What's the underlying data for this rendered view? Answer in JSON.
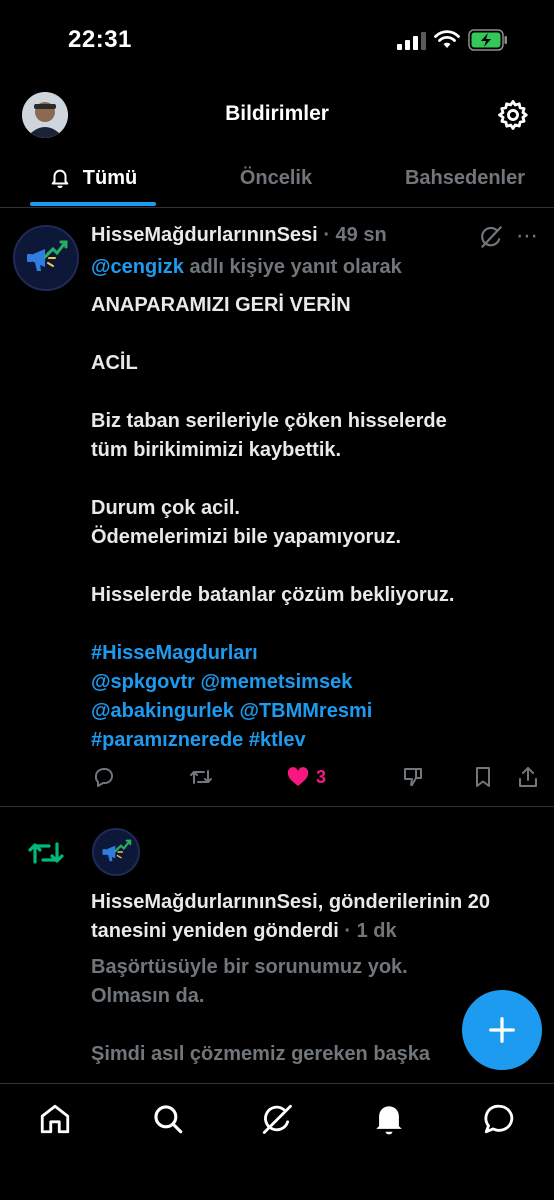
{
  "status_bar": {
    "time": "22:31",
    "signal_icon": "cellular-signal-icon",
    "wifi_icon": "wifi-icon",
    "battery_icon": "battery-charging-icon"
  },
  "header": {
    "title": "Bildirimler",
    "settings_icon": "gear-icon"
  },
  "tabs": [
    {
      "label": "Tümü",
      "active": true
    },
    {
      "label": "Öncelik",
      "active": false
    },
    {
      "label": "Bahsedenler",
      "active": false
    }
  ],
  "tweet": {
    "author": "HisseMağdurlarınınSesi",
    "separator": "·",
    "time_ago": "49 sn",
    "reply_to_handle": "@cengizk",
    "reply_suffix": "adlı kişiye yanıt olarak",
    "body": "ANAPARAMIZI GERİ VERİN\n\nACİL\n\nBiz taban serileriyle çöken hisselerde\ntüm  birikimimizi kaybettik.\n\nDurum çok acil.\nÖdemelerimizi bile yapamıyoruz.\n\nHisselerde batanlar çözüm bekliyoruz.",
    "tags": "#HisseMagdurları\n@spkgovtr @memetsimsek\n@abakingurlek @TBMMresmi\n#paramıznerede #ktlev",
    "like_count": "3",
    "like_color": "#f91880"
  },
  "repost_notification": {
    "text": "HisseMağdurlarınınSesi, gönderilerinin 20 tanesini yeniden gönderdi",
    "separator": "·",
    "time_ago": "1 dk",
    "preview": "Başörtüsüyle bir sorunumuz yok.\nOlmasın da.\n\nŞimdi asıl çözmemiz gereken başka",
    "icon_color": "#00ba7c"
  },
  "colors": {
    "accent": "#1d9bf0",
    "background": "#000000",
    "muted": "#71767b"
  },
  "bottom_nav": [
    "home-icon",
    "search-icon",
    "grok-icon",
    "notifications-bell-icon",
    "messages-icon"
  ]
}
